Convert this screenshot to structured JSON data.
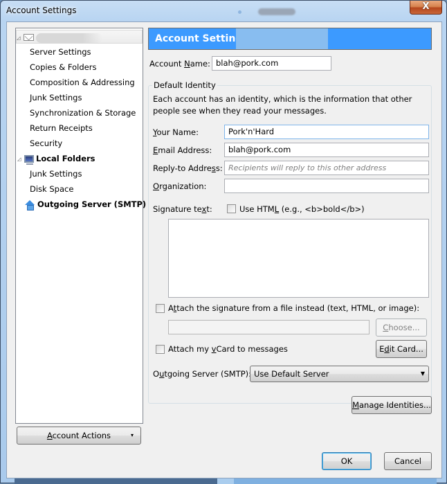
{
  "window": {
    "title": "Account Settings",
    "close_label": "X"
  },
  "tree": {
    "items": [
      {
        "label": "",
        "type": "account",
        "icon": "mail-icon",
        "selected": true,
        "redacted": true
      },
      {
        "label": "Server Settings",
        "type": "child"
      },
      {
        "label": "Copies & Folders",
        "type": "child"
      },
      {
        "label": "Composition & Addressing",
        "type": "child"
      },
      {
        "label": "Junk Settings",
        "type": "child"
      },
      {
        "label": "Synchronization & Storage",
        "type": "child"
      },
      {
        "label": "Return Receipts",
        "type": "child"
      },
      {
        "label": "Security",
        "type": "child"
      },
      {
        "label": "Local Folders",
        "type": "account",
        "icon": "computer-icon"
      },
      {
        "label": "Junk Settings",
        "type": "child"
      },
      {
        "label": "Disk Space",
        "type": "child"
      },
      {
        "label": "Outgoing Server (SMTP)",
        "type": "account",
        "icon": "outgoing-server-icon"
      }
    ]
  },
  "account_actions": {
    "label_pre": "",
    "label_accel": "A",
    "label_post": "ccount Actions",
    "arrow": "▾"
  },
  "main": {
    "banner_title": "Account Settings -",
    "account_name": {
      "label_pre": "Account ",
      "label_accel": "N",
      "label_post": "ame:",
      "value": "blah@pork.com"
    },
    "default_identity": {
      "caption": "Default Identity",
      "description": "Each account has an identity, which is the information that other people see when they read your messages.",
      "your_name": {
        "label_pre": "",
        "label_accel": "Y",
        "label_post": "our Name:",
        "value": "Pork'n'Hard"
      },
      "email": {
        "label_pre": "",
        "label_accel": "E",
        "label_post": "mail Address:",
        "value": "blah@pork.com"
      },
      "reply_to": {
        "label_pre": "Reply-to Addre",
        "label_accel": "s",
        "label_post": "s:",
        "value": "",
        "placeholder": "Recipients will reply to this other address"
      },
      "organization": {
        "label_pre": "",
        "label_accel": "O",
        "label_post": "rganization:",
        "value": ""
      },
      "signature": {
        "label_pre": "Signature te",
        "label_accel": "x",
        "label_post": "t:",
        "use_html_pre": "Use HTM",
        "use_html_accel": "L",
        "use_html_post": " (e.g., <b>bold</b>)",
        "use_html_checked": false,
        "value": ""
      },
      "attach_file": {
        "label_pre": "A",
        "label_accel": "t",
        "label_post": "tach the signature from a file instead (text, HTML, or image):",
        "checked": false,
        "path_value": "",
        "choose_pre": "",
        "choose_accel": "C",
        "choose_post": "hoose..."
      },
      "vcard": {
        "label_pre": "Attach my ",
        "label_accel": "v",
        "label_post": "Card to messages",
        "checked": false,
        "edit_pre": "E",
        "edit_accel": "d",
        "edit_post": "it Card..."
      },
      "outgoing_server": {
        "label_pre": "O",
        "label_accel": "u",
        "label_post": "tgoing Server (SMTP):",
        "selected": "Use Default Server",
        "arrow": "▼"
      }
    },
    "manage_identities": {
      "pre": "",
      "accel": "M",
      "post": "anage Identities..."
    }
  },
  "footer": {
    "ok_label": "OK",
    "cancel_label": "Cancel"
  }
}
